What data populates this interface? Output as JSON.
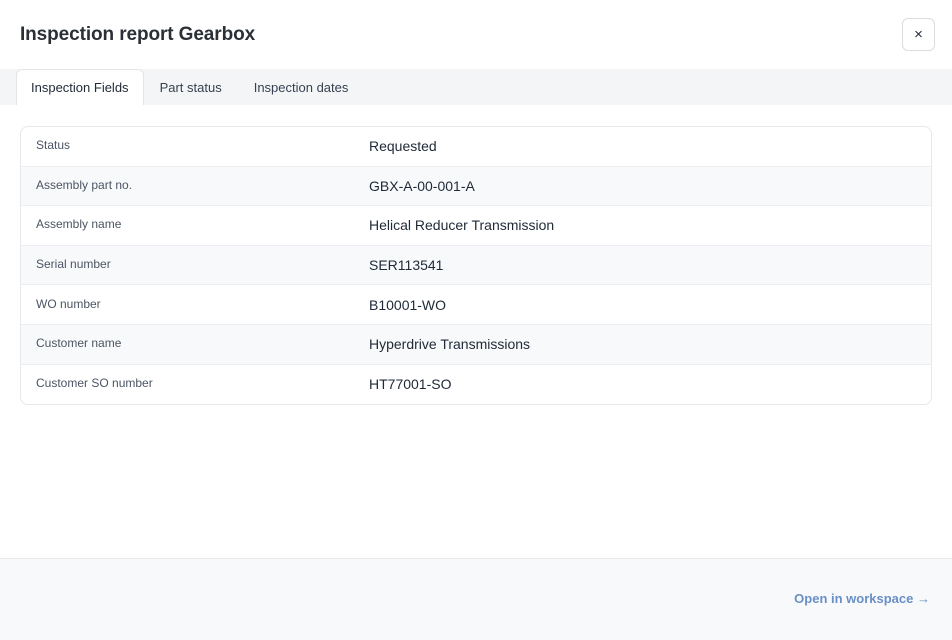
{
  "header": {
    "title": "Inspection report Gearbox",
    "close_label": "×"
  },
  "tabs": [
    {
      "label": "Inspection Fields",
      "active": true
    },
    {
      "label": "Part status",
      "active": false
    },
    {
      "label": "Inspection dates",
      "active": false
    }
  ],
  "fields": [
    {
      "label": "Status",
      "value": "Requested"
    },
    {
      "label": "Assembly part no.",
      "value": "GBX-A-00-001-A"
    },
    {
      "label": "Assembly name",
      "value": "Helical Reducer Transmission"
    },
    {
      "label": "Serial number",
      "value": "SER113541"
    },
    {
      "label": "WO number",
      "value": "B10001-WO"
    },
    {
      "label": "Customer name",
      "value": "Hyperdrive Transmissions"
    },
    {
      "label": "Customer SO number",
      "value": "HT77001-SO"
    }
  ],
  "footer": {
    "open_link_label": "Open in workspace →"
  },
  "colors": {
    "accent_link": "#6a8fc6",
    "tabbar_bg": "#f4f5f7"
  }
}
